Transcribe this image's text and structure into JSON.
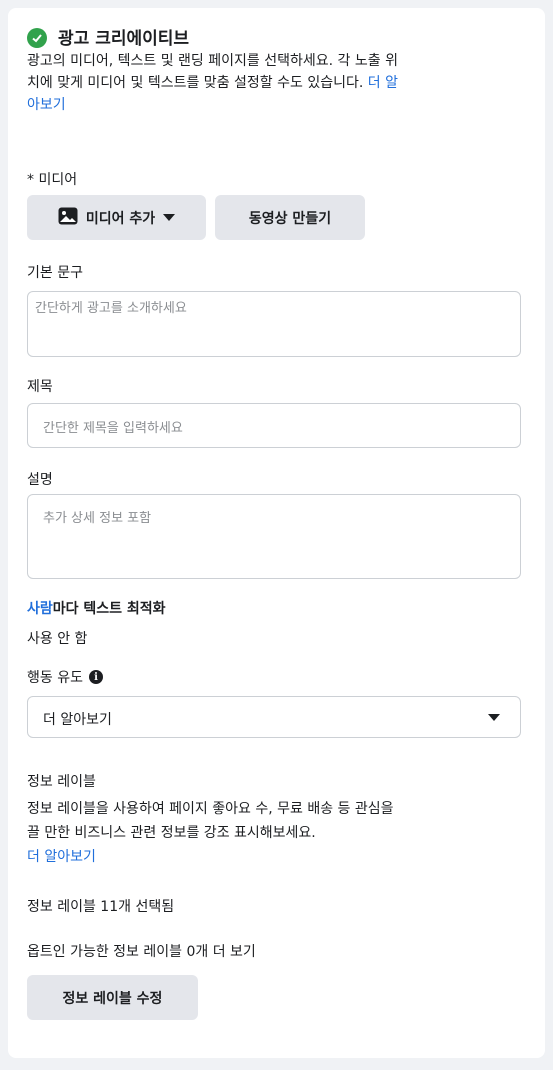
{
  "section": {
    "title": "광고 크리에이티브",
    "desc_line1": "광고의 미디어, 텍스트 및 랜딩 페이지를 선택하세요. 각 노출 위",
    "desc_line2": "치에 맞게 미디어 및 텍스트를 맞춤 설정할 수도 있습니다. ",
    "desc_link_a": "더 알",
    "desc_link_b": "아보기"
  },
  "media": {
    "label": "* 미디어",
    "add_label": "미디어 추가",
    "create_video_label": "동영상 만들기"
  },
  "primary_text": {
    "label": "기본 문구",
    "placeholder": "간단하게 광고를 소개하세요"
  },
  "headline": {
    "label": "제목",
    "placeholder": "간단한 제목을 입력하세요"
  },
  "description": {
    "label": "설명",
    "placeholder": "추가 상세 정보 포함"
  },
  "optimization": {
    "title_link": "사람",
    "title_rest": "마다 텍스트 최적화",
    "value": "사용 안 함"
  },
  "cta": {
    "label": "행동 유도",
    "selected": "더 알아보기"
  },
  "info_labels": {
    "title": "정보 레이블",
    "desc_line1": "정보 레이블을 사용하여 페이지 좋아요 수, 무료 배송 등 관심을",
    "desc_line2": "끌 만한 비즈니스 관련 정보를 강조 표시해보세요.",
    "learn_more": "더 알아보기",
    "selected_text": "정보 레이블 11개 선택됨",
    "optin_text": "옵트인 가능한 정보 레이블 0개 더 보기",
    "edit_button": "정보 레이블 수정"
  },
  "colors": {
    "accent": "#216fdb",
    "success": "#31a24c",
    "button_bg": "#e4e6eb"
  },
  "icons": [
    "check-circle-icon",
    "image-icon",
    "caret-down-icon",
    "info-icon"
  ]
}
